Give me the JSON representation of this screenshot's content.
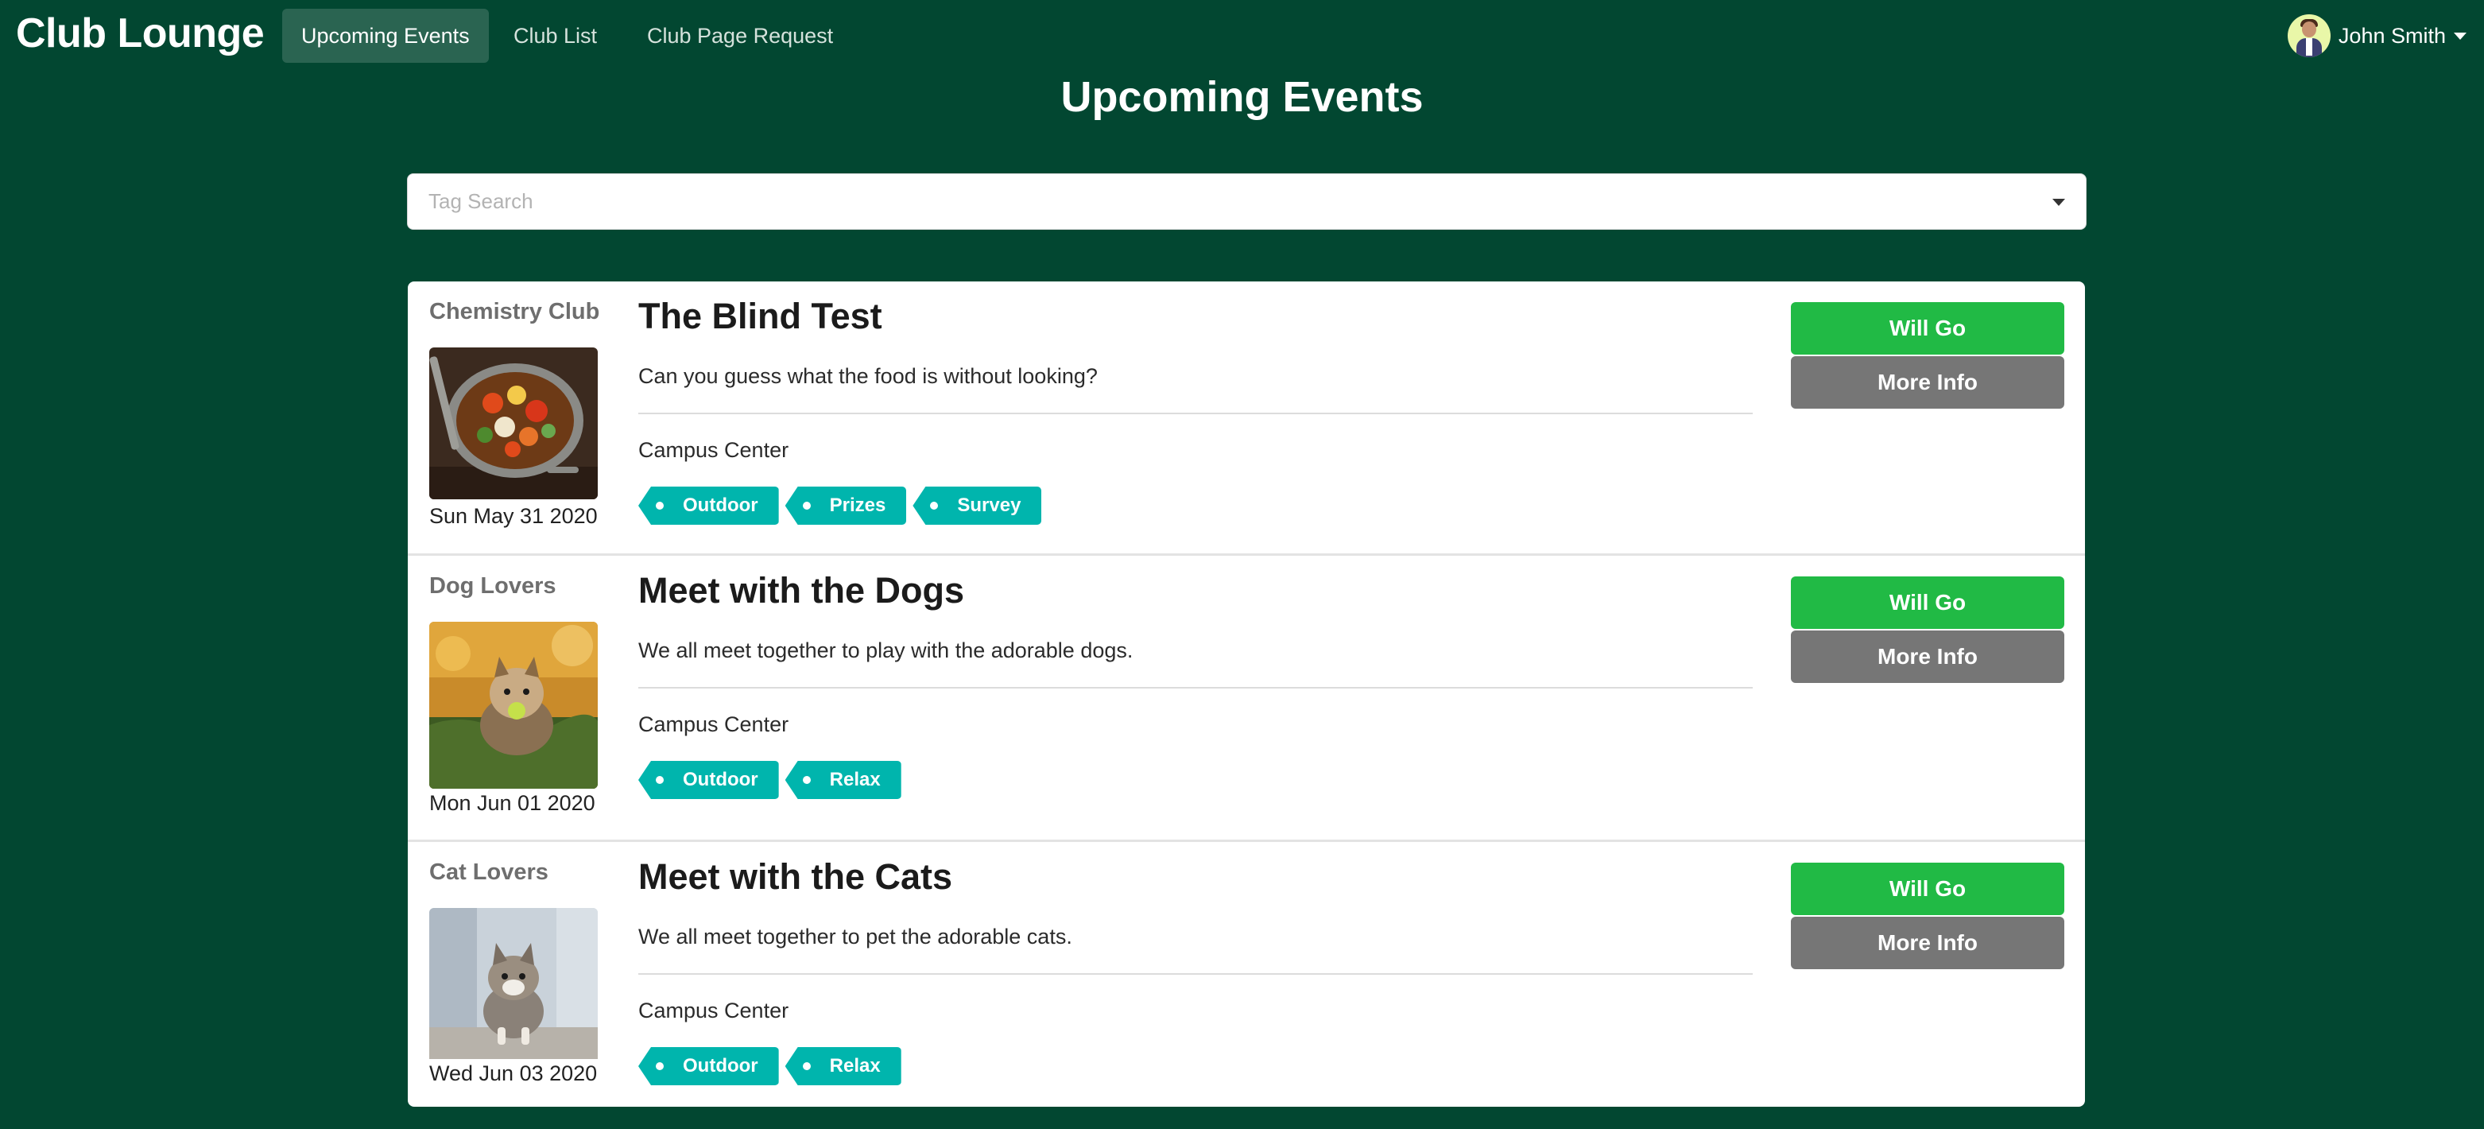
{
  "nav": {
    "brand": "Club Lounge",
    "items": [
      {
        "label": "Upcoming Events",
        "active": true
      },
      {
        "label": "Club List",
        "active": false
      },
      {
        "label": "Club Page Request",
        "active": false
      }
    ],
    "user": {
      "name": "John Smith",
      "avatar_icon": "user-avatar-icon"
    }
  },
  "page": {
    "title": "Upcoming Events"
  },
  "search": {
    "placeholder": "Tag Search",
    "value": ""
  },
  "events": [
    {
      "club": "Chemistry Club",
      "image": "food-pot-image",
      "date": "Sun May 31 2020",
      "title": "The Blind Test",
      "description": "Can you guess what the food is without looking?",
      "location": "Campus Center",
      "tags": [
        "Outdoor",
        "Prizes",
        "Survey"
      ],
      "will_go_label": "Will Go",
      "more_info_label": "More Info"
    },
    {
      "club": "Dog Lovers",
      "image": "dog-with-ball-image",
      "date": "Mon Jun 01 2020",
      "title": "Meet with the Dogs",
      "description": "We all meet together to play with the adorable dogs.",
      "location": "Campus Center",
      "tags": [
        "Outdoor",
        "Relax"
      ],
      "will_go_label": "Will Go",
      "more_info_label": "More Info"
    },
    {
      "club": "Cat Lovers",
      "image": "kitten-image",
      "date": "Wed Jun 03 2020",
      "title": "Meet with the Cats",
      "description": "We all meet together to pet the adorable cats.",
      "location": "Campus Center",
      "tags": [
        "Outdoor",
        "Relax"
      ],
      "will_go_label": "Will Go",
      "more_info_label": "More Info"
    }
  ],
  "colors": {
    "background": "#024731",
    "active_nav": "#2a6451",
    "will_go": "#21ba45",
    "more_info": "#767676",
    "tag": "#00b5ad"
  }
}
